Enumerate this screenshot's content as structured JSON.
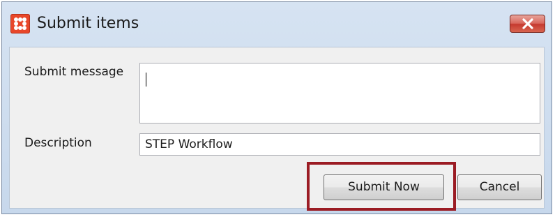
{
  "window": {
    "title": "Submit items",
    "app_icon": "grid-of-dots-icon",
    "close_icon": "close-icon",
    "close_color": "#c5392f"
  },
  "form": {
    "submit_message_label": "Submit message",
    "submit_message_value": "",
    "description_label": "Description",
    "description_value": "STEP Workflow"
  },
  "buttons": {
    "submit_label": "Submit Now",
    "cancel_label": "Cancel"
  },
  "annotation": {
    "highlight_color": "#9b1c24",
    "highlight_target": "submit-now-button"
  }
}
